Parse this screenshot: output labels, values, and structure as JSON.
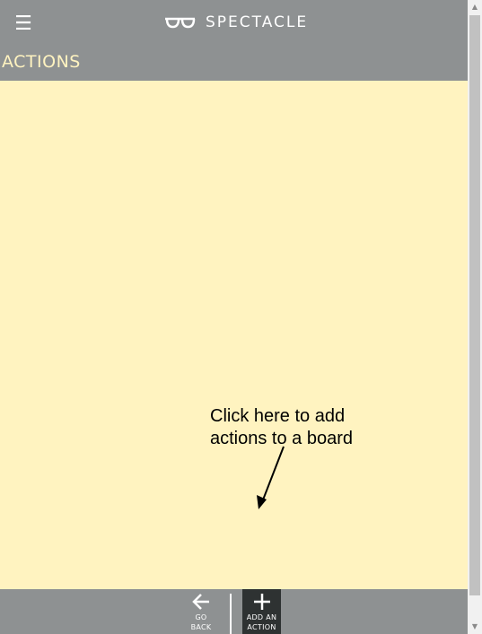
{
  "header": {
    "menu_icon": "☰",
    "brand_name": "SPECTACLE",
    "section_title": "ACTIONS"
  },
  "annotation": {
    "line1": "Click here to add",
    "line2": "actions to a board"
  },
  "footer": {
    "back": {
      "label_line1": "GO",
      "label_line2": "BACK"
    },
    "add": {
      "label_line1": "ADD AN",
      "label_line2": "ACTION"
    }
  },
  "colors": {
    "header_bg": "#8e9192",
    "content_bg": "#fff3c0",
    "title_color": "#fff3c0",
    "add_button_bg": "#2e3232"
  },
  "scrollbar": {
    "up_glyph": "▲",
    "down_glyph": "▼"
  }
}
